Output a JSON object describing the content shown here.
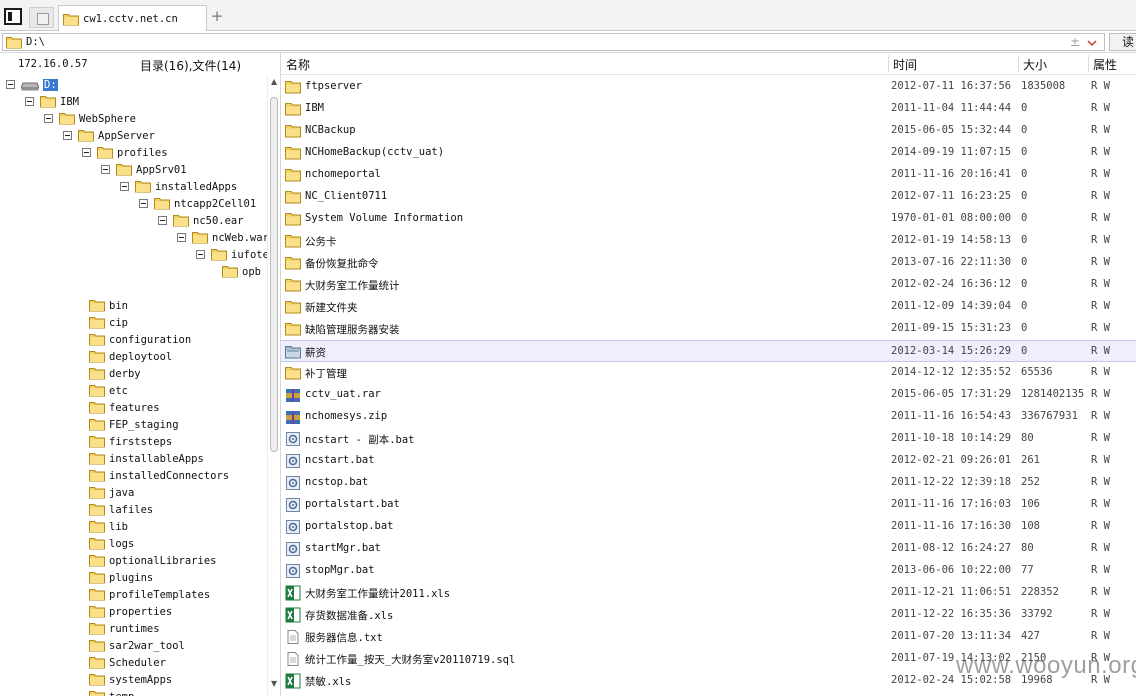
{
  "tabbar": {
    "tab_title": "cw1.cctv.net.cn",
    "add_symbol": "+"
  },
  "address": {
    "path": "D:\\",
    "updown": "±",
    "read_label": "读"
  },
  "left_header": {
    "host": "172.16.0.57",
    "counts": "目录(16),文件(14)"
  },
  "columns": {
    "name": "名称",
    "time": "时间",
    "size": "大小",
    "attr": "属性"
  },
  "tree": [
    {
      "label": "D:",
      "depth": 0,
      "type": "drive",
      "toggle": true,
      "selected": true
    },
    {
      "label": "IBM",
      "depth": 1,
      "type": "folder",
      "toggle": true
    },
    {
      "label": "WebSphere",
      "depth": 2,
      "type": "folder",
      "toggle": true
    },
    {
      "label": "AppServer",
      "depth": 3,
      "type": "folder",
      "toggle": true
    },
    {
      "label": "profiles",
      "depth": 4,
      "type": "folder",
      "toggle": true
    },
    {
      "label": "AppSrv01",
      "depth": 5,
      "type": "folder",
      "toggle": true
    },
    {
      "label": "installedApps",
      "depth": 6,
      "type": "folder",
      "toggle": true
    },
    {
      "label": "ntcapp2Cell01",
      "depth": 7,
      "type": "folder",
      "toggle": true
    },
    {
      "label": "nc50.ear",
      "depth": 8,
      "type": "folder",
      "toggle": true
    },
    {
      "label": "ncWeb.war",
      "depth": 9,
      "type": "folder",
      "toggle": true
    },
    {
      "label": "iufote",
      "depth": 10,
      "type": "folder",
      "toggle": true
    },
    {
      "label": "opb",
      "depth": 11,
      "type": "folder",
      "toggle": false
    },
    {
      "label": "",
      "depth": 0,
      "type": "gap",
      "toggle": false
    },
    {
      "label": "bin",
      "depth": 4,
      "type": "folder",
      "toggle": false
    },
    {
      "label": "cip",
      "depth": 4,
      "type": "folder",
      "toggle": false
    },
    {
      "label": "configuration",
      "depth": 4,
      "type": "folder",
      "toggle": false
    },
    {
      "label": "deploytool",
      "depth": 4,
      "type": "folder",
      "toggle": false
    },
    {
      "label": "derby",
      "depth": 4,
      "type": "folder",
      "toggle": false
    },
    {
      "label": "etc",
      "depth": 4,
      "type": "folder",
      "toggle": false
    },
    {
      "label": "features",
      "depth": 4,
      "type": "folder",
      "toggle": false
    },
    {
      "label": "FEP_staging",
      "depth": 4,
      "type": "folder",
      "toggle": false
    },
    {
      "label": "firststeps",
      "depth": 4,
      "type": "folder",
      "toggle": false
    },
    {
      "label": "installableApps",
      "depth": 4,
      "type": "folder",
      "toggle": false
    },
    {
      "label": "installedConnectors",
      "depth": 4,
      "type": "folder",
      "toggle": false
    },
    {
      "label": "java",
      "depth": 4,
      "type": "folder",
      "toggle": false
    },
    {
      "label": "lafiles",
      "depth": 4,
      "type": "folder",
      "toggle": false
    },
    {
      "label": "lib",
      "depth": 4,
      "type": "folder",
      "toggle": false
    },
    {
      "label": "logs",
      "depth": 4,
      "type": "folder",
      "toggle": false
    },
    {
      "label": "optionalLibraries",
      "depth": 4,
      "type": "folder",
      "toggle": false
    },
    {
      "label": "plugins",
      "depth": 4,
      "type": "folder",
      "toggle": false
    },
    {
      "label": "profileTemplates",
      "depth": 4,
      "type": "folder",
      "toggle": false
    },
    {
      "label": "properties",
      "depth": 4,
      "type": "folder",
      "toggle": false
    },
    {
      "label": "runtimes",
      "depth": 4,
      "type": "folder",
      "toggle": false
    },
    {
      "label": "sar2war_tool",
      "depth": 4,
      "type": "folder",
      "toggle": false
    },
    {
      "label": "Scheduler",
      "depth": 4,
      "type": "folder",
      "toggle": false
    },
    {
      "label": "systemApps",
      "depth": 4,
      "type": "folder",
      "toggle": false
    },
    {
      "label": "temp",
      "depth": 4,
      "type": "folder",
      "toggle": false
    }
  ],
  "files": [
    {
      "name": "ftpserver",
      "time": "2012-07-11 16:37:56",
      "size": "1835008",
      "attr": "R W",
      "icon": "folder"
    },
    {
      "name": "IBM",
      "time": "2011-11-04 11:44:44",
      "size": "0",
      "attr": "R W",
      "icon": "folder"
    },
    {
      "name": "NCBackup",
      "time": "2015-06-05 15:32:44",
      "size": "0",
      "attr": "R W",
      "icon": "folder"
    },
    {
      "name": "NCHomeBackup(cctv_uat)",
      "time": "2014-09-19 11:07:15",
      "size": "0",
      "attr": "R W",
      "icon": "folder"
    },
    {
      "name": "nchomeportal",
      "time": "2011-11-16 20:16:41",
      "size": "0",
      "attr": "R W",
      "icon": "folder"
    },
    {
      "name": "NC_Client0711",
      "time": "2012-07-11 16:23:25",
      "size": "0",
      "attr": "R W",
      "icon": "folder"
    },
    {
      "name": "System Volume Information",
      "time": "1970-01-01 08:00:00",
      "size": "0",
      "attr": "R W",
      "icon": "folder"
    },
    {
      "name": "公务卡",
      "time": "2012-01-19 14:58:13",
      "size": "0",
      "attr": "R W",
      "icon": "folder"
    },
    {
      "name": "备份恢复批命令",
      "time": "2013-07-16 22:11:30",
      "size": "0",
      "attr": "R W",
      "icon": "folder"
    },
    {
      "name": "大财务室工作量统计",
      "time": "2012-02-24 16:36:12",
      "size": "0",
      "attr": "R W",
      "icon": "folder"
    },
    {
      "name": "新建文件夹",
      "time": "2011-12-09 14:39:04",
      "size": "0",
      "attr": "R W",
      "icon": "folder"
    },
    {
      "name": "缺陷管理服务器安装",
      "time": "2011-09-15 15:31:23",
      "size": "0",
      "attr": "R W",
      "icon": "folder"
    },
    {
      "name": "薪资",
      "time": "2012-03-14 15:26:29",
      "size": "0",
      "attr": "R W",
      "icon": "folder-open",
      "selected": true
    },
    {
      "name": "补丁管理",
      "time": "2014-12-12 12:35:52",
      "size": "65536",
      "attr": "R W",
      "icon": "folder"
    },
    {
      "name": "cctv_uat.rar",
      "time": "2015-06-05 17:31:29",
      "size": "1281402135",
      "attr": "R W",
      "icon": "archive"
    },
    {
      "name": "nchomesys.zip",
      "time": "2011-11-16 16:54:43",
      "size": "336767931",
      "attr": "R W",
      "icon": "archive"
    },
    {
      "name": "ncstart - 副本.bat",
      "time": "2011-10-18 10:14:29",
      "size": "80",
      "attr": "R W",
      "icon": "bat"
    },
    {
      "name": "ncstart.bat",
      "time": "2012-02-21 09:26:01",
      "size": "261",
      "attr": "R W",
      "icon": "bat"
    },
    {
      "name": "ncstop.bat",
      "time": "2011-12-22 12:39:18",
      "size": "252",
      "attr": "R W",
      "icon": "bat"
    },
    {
      "name": "portalstart.bat",
      "time": "2011-11-16 17:16:03",
      "size": "106",
      "attr": "R W",
      "icon": "bat"
    },
    {
      "name": "portalstop.bat",
      "time": "2011-11-16 17:16:30",
      "size": "108",
      "attr": "R W",
      "icon": "bat"
    },
    {
      "name": "startMgr.bat",
      "time": "2011-08-12 16:24:27",
      "size": "80",
      "attr": "R W",
      "icon": "bat"
    },
    {
      "name": "stopMgr.bat",
      "time": "2013-06-06 10:22:00",
      "size": "77",
      "attr": "R W",
      "icon": "bat"
    },
    {
      "name": "大财务室工作量统计2011.xls",
      "time": "2011-12-21 11:06:51",
      "size": "228352",
      "attr": "R W",
      "icon": "excel"
    },
    {
      "name": "存货数据准备.xls",
      "time": "2011-12-22 16:35:36",
      "size": "33792",
      "attr": "R W",
      "icon": "excel"
    },
    {
      "name": "服务器信息.txt",
      "time": "2011-07-20 13:11:34",
      "size": "427",
      "attr": "R W",
      "icon": "text"
    },
    {
      "name": "统计工作量_按天_大财务室v20110719.sql",
      "time": "2011-07-19 14:13:02",
      "size": "2150",
      "attr": "R W",
      "icon": "text"
    },
    {
      "name": "禁敏.xls",
      "time": "2012-02-24 15:02:58",
      "size": "19968",
      "attr": "R W",
      "icon": "excel"
    }
  ],
  "watermark": "www.wooyun.org"
}
